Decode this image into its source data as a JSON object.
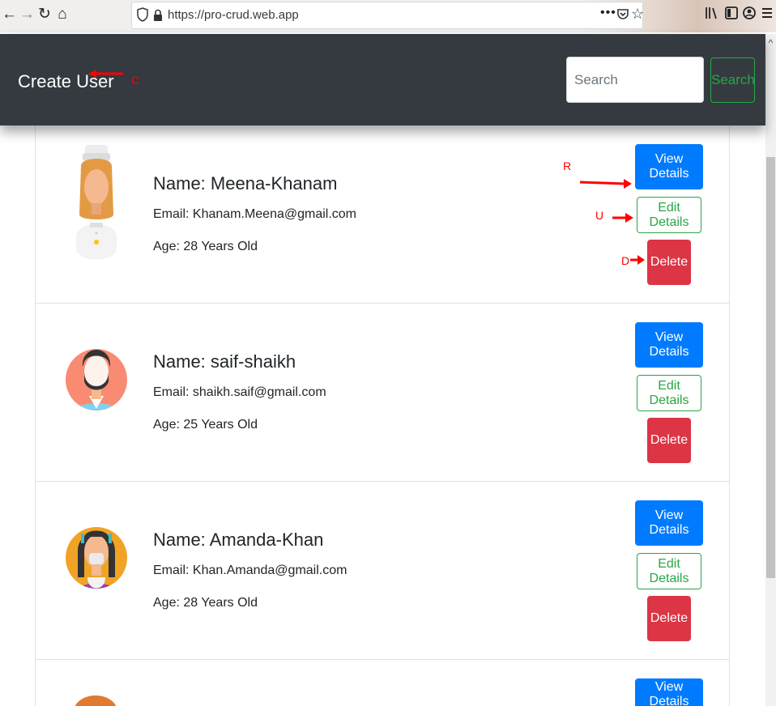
{
  "browser": {
    "url": "https://pro-crud.web.app"
  },
  "navbar": {
    "brand": "Create User",
    "search_placeholder": "Search",
    "search_button": "Search"
  },
  "users": [
    {
      "name": "Name: Meena-Khanam",
      "email": "Email: Khanam.Meena@gmail.com",
      "age": "Age: 28 Years Old"
    },
    {
      "name": "Name: saif-shaikh",
      "email": "Email: shaikh.saif@gmail.com",
      "age": "Age: 25 Years Old"
    },
    {
      "name": "Name: Amanda-Khan",
      "email": "Email: Khan.Amanda@gmail.com",
      "age": "Age: 28 Years Old"
    }
  ],
  "buttons": {
    "view": "View Details",
    "edit": "Edit Details",
    "delete": "Delete"
  },
  "annotations": {
    "c": "C",
    "r": "R",
    "u": "U",
    "d": "D"
  },
  "colors": {
    "navbar": "#343a40",
    "primary": "#007bff",
    "success": "#28a745",
    "danger": "#dc3545",
    "annotation": "#ff0000"
  }
}
